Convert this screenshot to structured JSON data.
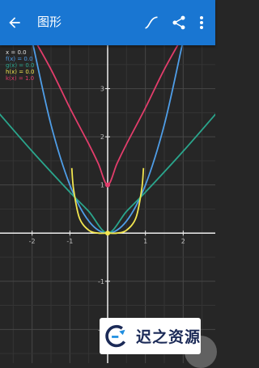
{
  "appbar": {
    "title": "图形",
    "background": "#1976d2"
  },
  "icons": {
    "back": "arrow-back-icon",
    "curve": "curve-icon",
    "share": "share-icon",
    "more": "more-vert-icon"
  },
  "values": [
    {
      "label": "x = 0.0",
      "color": "#e0e0e0"
    },
    {
      "label": "f(x) = 0.0",
      "color": "#4f9ee8"
    },
    {
      "label": "g(x) = 0.0",
      "color": "#2aa58c"
    },
    {
      "label": "h(x) = 0.0",
      "color": "#f2e650"
    },
    {
      "label": "k(x) = 1.0",
      "color": "#e23d6b"
    }
  ],
  "chart_data": {
    "type": "line",
    "xlim": [
      -2.85,
      2.85
    ],
    "ylim": [
      -2.7,
      3.9
    ],
    "x_ticks": [
      -2,
      -1,
      1,
      2
    ],
    "y_ticks": [
      -2,
      -1,
      1,
      2,
      3,
      4
    ],
    "grid": true,
    "series": [
      {
        "name": "f(x)",
        "color": "#4f9ee8",
        "x": [
          -2.0,
          -1.5,
          -1.0,
          -0.5,
          0.0,
          0.5,
          1.0,
          1.5,
          2.0
        ],
        "y": [
          4.0,
          2.25,
          1.0,
          0.25,
          0.0,
          0.25,
          1.0,
          2.25,
          4.0
        ]
      },
      {
        "name": "g(x)",
        "color": "#2aa58c",
        "x": [
          -3.0,
          -2.0,
          -1.0,
          -0.5,
          0.0,
          0.5,
          1.0,
          2.0,
          3.0
        ],
        "y": [
          2.6,
          1.7,
          0.85,
          0.45,
          0.0,
          0.45,
          0.85,
          1.7,
          2.6
        ]
      },
      {
        "name": "h(x)",
        "color": "#f2e650",
        "x": [
          -0.95,
          -0.9,
          -0.75,
          -0.5,
          -0.25,
          0.0,
          0.25,
          0.5,
          0.75,
          0.9,
          0.95
        ],
        "y": [
          1.35,
          0.9,
          0.32,
          0.06,
          0.0,
          0.0,
          0.0,
          0.06,
          0.32,
          0.9,
          1.35
        ]
      },
      {
        "name": "k(x)",
        "color": "#e23d6b",
        "x": [
          -2.0,
          -1.5,
          -1.0,
          -0.5,
          -0.25,
          0.0,
          0.25,
          0.5,
          1.0,
          1.5,
          2.0
        ],
        "y": [
          4.1,
          3.4,
          2.6,
          1.85,
          1.45,
          1.0,
          1.45,
          1.85,
          2.6,
          3.4,
          4.1
        ]
      }
    ],
    "markers": [
      {
        "x": 0.0,
        "y": 0.0,
        "color": "#f2e650"
      },
      {
        "x": 0.0,
        "y": 1.0,
        "color": "#e23d6b"
      }
    ]
  },
  "watermark": {
    "text": "迟之资源"
  }
}
